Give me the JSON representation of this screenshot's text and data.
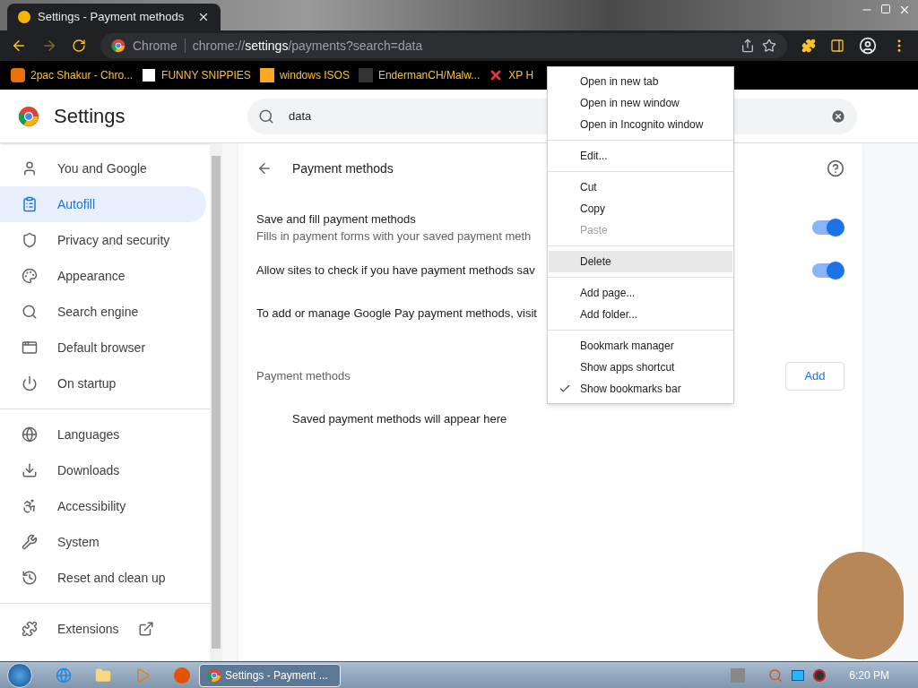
{
  "browser": {
    "tab_title": "Settings - Payment methods",
    "omnibox_label": "Chrome",
    "url_prefix": "chrome://",
    "url_host": "settings",
    "url_path": "/payments?search=data"
  },
  "bookmarks": [
    {
      "label": "2pac Shakur - Chro..."
    },
    {
      "label": "FUNNY SNIPPIES"
    },
    {
      "label": "windows ISOS"
    },
    {
      "label": "EndermanCH/Malw..."
    },
    {
      "label": "XP H"
    }
  ],
  "header": {
    "title": "Settings",
    "search_value": "data"
  },
  "sidebar": {
    "groups": [
      [
        {
          "label": "You and Google",
          "selected": false
        },
        {
          "label": "Autofill",
          "selected": true
        },
        {
          "label": "Privacy and security",
          "selected": false
        },
        {
          "label": "Appearance",
          "selected": false
        },
        {
          "label": "Search engine",
          "selected": false
        },
        {
          "label": "Default browser",
          "selected": false
        },
        {
          "label": "On startup",
          "selected": false
        }
      ],
      [
        {
          "label": "Languages",
          "selected": false
        },
        {
          "label": "Downloads",
          "selected": false
        },
        {
          "label": "Accessibility",
          "selected": false
        },
        {
          "label": "System",
          "selected": false
        },
        {
          "label": "Reset and clean up",
          "selected": false
        }
      ],
      [
        {
          "label": "Extensions",
          "selected": false,
          "external": true
        }
      ]
    ]
  },
  "page": {
    "title": "Payment methods",
    "settings": [
      {
        "kind": "toggle",
        "label": "Save and fill payment methods",
        "sublabel": "Fills in payment forms with your saved payment meth",
        "on": true
      },
      {
        "kind": "toggle",
        "label": "Allow sites to check if you have payment methods sav",
        "on": true
      },
      {
        "kind": "text",
        "label": "To add or manage Google Pay payment methods, visit"
      }
    ],
    "section_title": "Payment methods",
    "add_button": "Add",
    "empty_text": "Saved payment methods will appear here"
  },
  "context_menu": {
    "groups": [
      [
        {
          "label": "Open in new tab",
          "disabled": false,
          "selected": false,
          "checked": false
        },
        {
          "label": "Open in new window",
          "disabled": false,
          "selected": false,
          "checked": false
        },
        {
          "label": "Open in Incognito window",
          "disabled": false,
          "selected": false,
          "checked": false
        }
      ],
      [
        {
          "label": "Edit...",
          "disabled": false,
          "selected": false,
          "checked": false
        }
      ],
      [
        {
          "label": "Cut",
          "disabled": false,
          "selected": false,
          "checked": false
        },
        {
          "label": "Copy",
          "disabled": false,
          "selected": false,
          "checked": false
        },
        {
          "label": "Paste",
          "disabled": true,
          "selected": false,
          "checked": false
        }
      ],
      [
        {
          "label": "Delete",
          "disabled": false,
          "selected": true,
          "checked": false
        }
      ],
      [
        {
          "label": "Add page...",
          "disabled": false,
          "selected": false,
          "checked": false
        },
        {
          "label": "Add folder...",
          "disabled": false,
          "selected": false,
          "checked": false
        }
      ],
      [
        {
          "label": "Bookmark manager",
          "disabled": false,
          "selected": false,
          "checked": false
        },
        {
          "label": "Show apps shortcut",
          "disabled": false,
          "selected": false,
          "checked": false
        },
        {
          "label": "Show bookmarks bar",
          "disabled": false,
          "selected": false,
          "checked": true
        }
      ]
    ]
  },
  "taskbar": {
    "task": "Settings - Payment ...",
    "time": "6:20 PM"
  }
}
